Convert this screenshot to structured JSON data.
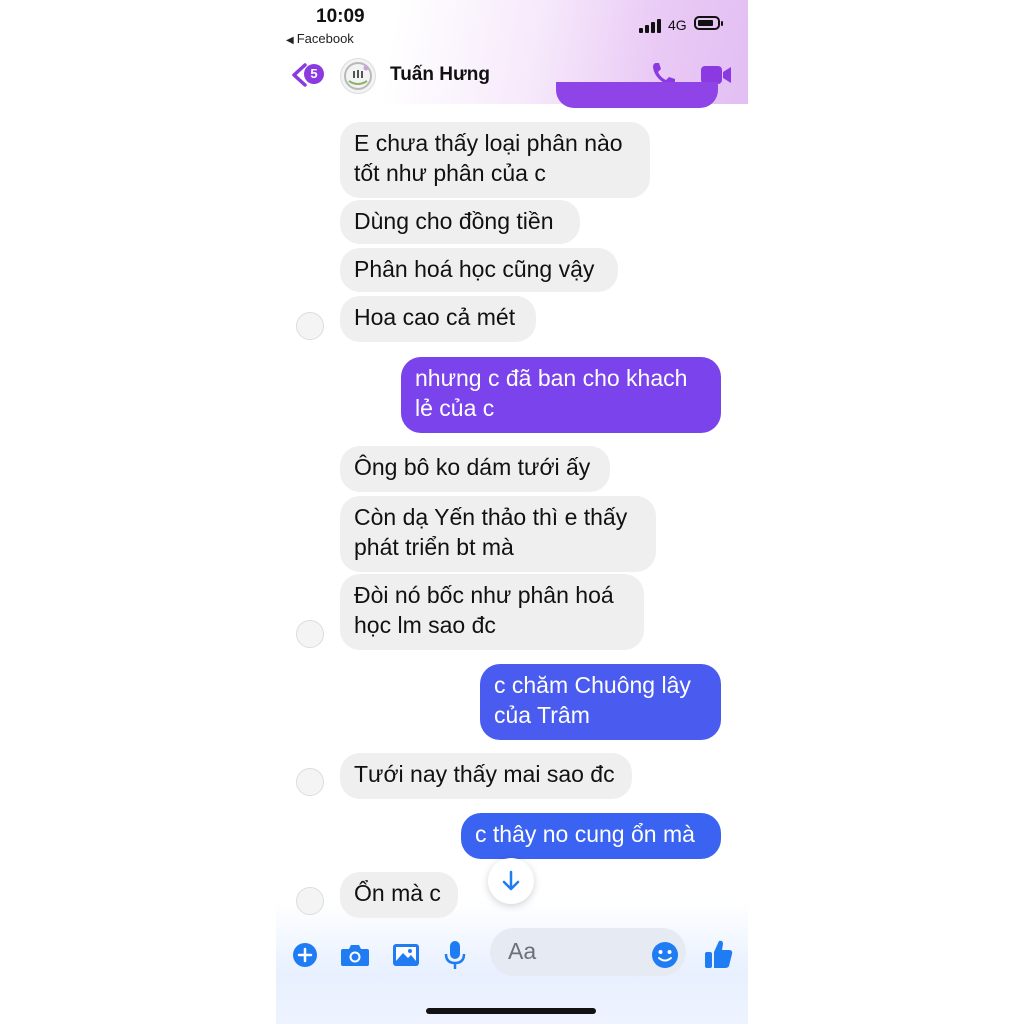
{
  "status_bar": {
    "time": "10:09",
    "back_app": "Facebook",
    "network": "4G"
  },
  "header": {
    "unread_count": "5",
    "contact_name": "Tuấn Hưng",
    "accent_color": "#8a3ae0"
  },
  "messages": [
    {
      "direction": "received",
      "lines": [
        "E chưa thấy loại phân nào",
        "tốt như phân của c"
      ]
    },
    {
      "direction": "received",
      "lines": [
        "Dùng cho đồng tiền"
      ]
    },
    {
      "direction": "received",
      "lines": [
        "Phân hoá học cũng vậy"
      ]
    },
    {
      "direction": "received",
      "lines": [
        "Hoa cao cả mét"
      ]
    },
    {
      "direction": "sent",
      "lines": [
        "nhưng c đã ban cho khach",
        "lẻ của c"
      ],
      "color": "#7a43ec"
    },
    {
      "direction": "received",
      "lines": [
        "Ông bô ko dám tưới ấy"
      ]
    },
    {
      "direction": "received",
      "lines": [
        "Còn dạ Yến thảo thì e thấy",
        "phát triển bt mà"
      ]
    },
    {
      "direction": "received",
      "lines": [
        "Đòi nó bốc như phân hoá",
        "học lm sao đc"
      ]
    },
    {
      "direction": "sent",
      "lines": [
        "c chăm Chuông lây",
        "của Trâm"
      ],
      "color": "#4a5bf0"
    },
    {
      "direction": "received",
      "lines": [
        "Tưới nay thấy mai sao đc"
      ]
    },
    {
      "direction": "sent",
      "lines": [
        "c thây no cung ổn mà"
      ],
      "color": "#3a63f2"
    },
    {
      "direction": "received",
      "lines": [
        "Ổn mà c"
      ]
    }
  ],
  "composer": {
    "placeholder": "Aa",
    "icons": [
      "plus-icon",
      "camera-icon",
      "image-icon",
      "microphone-icon",
      "emoji-icon",
      "thumbs-up-icon"
    ],
    "icon_color": "#1f7cf2"
  }
}
